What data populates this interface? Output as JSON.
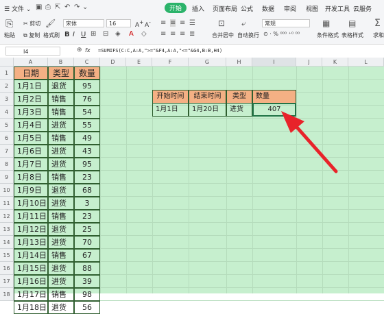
{
  "menu": {
    "file": "文件",
    "tabs": [
      "开始",
      "插入",
      "页面布局",
      "公式",
      "数据",
      "审阅",
      "视图",
      "开发工具",
      "云服务"
    ]
  },
  "ribbon": {
    "cut": "剪切",
    "paste": "粘贴",
    "copy": "复制",
    "format_painter": "格式刷",
    "font_name": "宋体",
    "font_size": "16",
    "merge_center": "合并居中",
    "wrap_text": "自动换行",
    "number_format": "常规",
    "cond_format": "条件格式",
    "table_style": "表格样式",
    "sum": "求和"
  },
  "formula_bar": {
    "cell_ref": "I4",
    "fx": "fx",
    "formula": "=SUMIFS(C:C,A:A,\">=\"&F4,A:A,\"<=\"&G4,B:B,H4)"
  },
  "columns": [
    "A",
    "B",
    "C",
    "D",
    "E",
    "F",
    "G",
    "H",
    "I",
    "J",
    "K",
    "L"
  ],
  "rows": [
    "1",
    "2",
    "3",
    "4",
    "5",
    "6",
    "7",
    "8",
    "9",
    "10",
    "11",
    "12",
    "13",
    "14",
    "15",
    "16",
    "17",
    "18"
  ],
  "table": {
    "headers": [
      "日期",
      "类型",
      "数量"
    ],
    "rows": [
      [
        "1月1日",
        "退货",
        "95"
      ],
      [
        "1月2日",
        "销售",
        "76"
      ],
      [
        "1月3日",
        "销售",
        "54"
      ],
      [
        "1月4日",
        "进货",
        "55"
      ],
      [
        "1月5日",
        "销售",
        "49"
      ],
      [
        "1月6日",
        "进货",
        "43"
      ],
      [
        "1月7日",
        "进货",
        "95"
      ],
      [
        "1月8日",
        "销售",
        "23"
      ],
      [
        "1月9日",
        "退货",
        "68"
      ],
      [
        "1月10日",
        "进货",
        "3"
      ],
      [
        "1月11日",
        "销售",
        "23"
      ],
      [
        "1月12日",
        "退货",
        "25"
      ],
      [
        "1月13日",
        "进货",
        "70"
      ],
      [
        "1月14日",
        "销售",
        "67"
      ],
      [
        "1月15日",
        "退货",
        "88"
      ],
      [
        "1月16日",
        "进货",
        "39"
      ],
      [
        "1月17日",
        "销售",
        "98"
      ],
      [
        "1月18日",
        "退货",
        "56"
      ]
    ]
  },
  "criteria": {
    "headers": [
      "开始时间",
      "结束时间",
      "类型",
      "数量"
    ],
    "values": [
      "1月1日",
      "1月20日",
      "进货",
      "407"
    ]
  },
  "colors": {
    "sheet_bg": "#c6efce",
    "header_fill": "#f4b084",
    "arrow": "#e8232a",
    "active_tab": "#2bb36a"
  }
}
